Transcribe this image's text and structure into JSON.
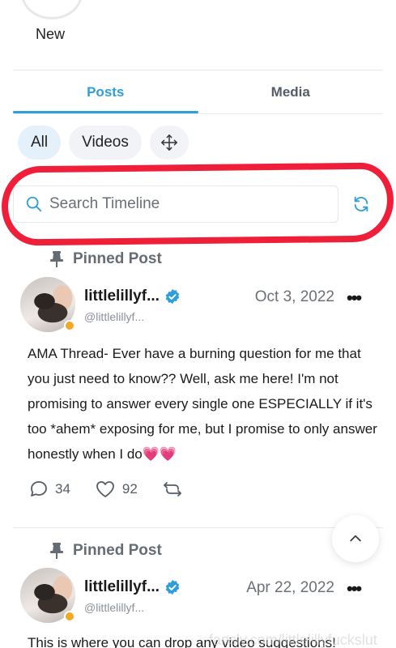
{
  "stories": {
    "new_label": "New"
  },
  "tabs": [
    {
      "label": "Posts",
      "active": true
    },
    {
      "label": "Media",
      "active": false
    }
  ],
  "filters": {
    "all_label": "All",
    "videos_label": "Videos",
    "move_icon": "move-arrows-icon"
  },
  "search": {
    "placeholder": "Search Timeline",
    "icon": "search-icon",
    "refresh_icon": "refresh-icon"
  },
  "highlight_color": "#ef1f3a",
  "accent_color": "#2e9ed8",
  "posts": [
    {
      "pinned_label": "Pinned Post",
      "author": "littlelillyf...",
      "handle": "@littlelillyf...",
      "date": "Oct 3, 2022",
      "more": "•••",
      "text": "AMA Thread- Ever have a burning question for me that you just need to know?? Well, ask me here! I'm not promising to answer every single one ESPECIALLY if it's too *ahem* exposing for me, but I promise to only answer honestly when I do💗💗",
      "comments": "34",
      "likes": "92",
      "repost_icon": "repost-icon"
    },
    {
      "pinned_label": "Pinned Post",
      "author": "littlelillyf...",
      "handle": "@littlelillyf...",
      "date": "Apr 22, 2022",
      "more": "•••",
      "text": "This is where you can drop any video suggestions!"
    }
  ],
  "watermark": "fansly.com/littlelillyfuckslut"
}
